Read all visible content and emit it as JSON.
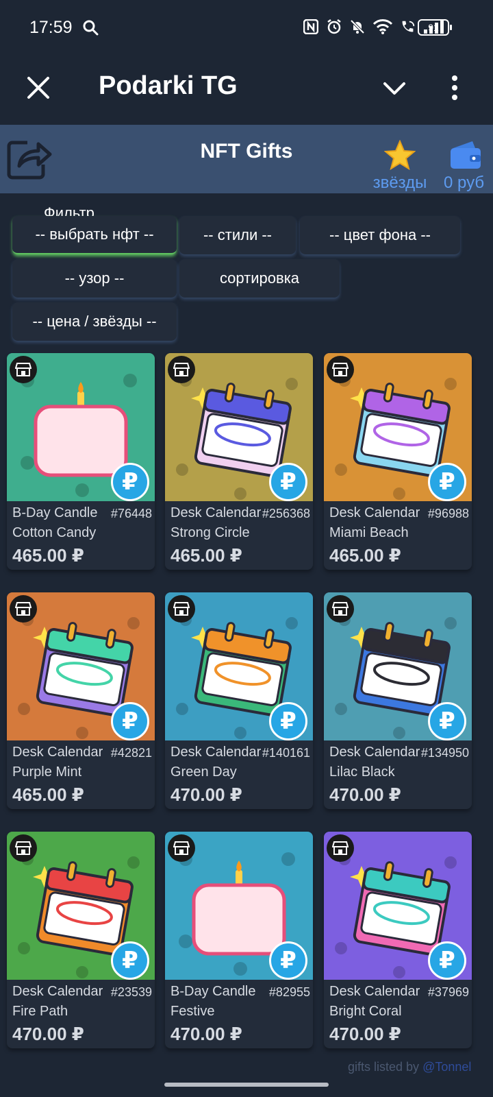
{
  "status_bar": {
    "time": "17:59",
    "battery": "91",
    "icons": [
      "search-icon",
      "nfc-icon",
      "alarm-icon",
      "mute-icon",
      "wifi-icon",
      "wifi-call-icon",
      "signal-icon"
    ]
  },
  "app_bar": {
    "title": "Podarki TG"
  },
  "banner": {
    "title": "NFT Gifts",
    "stars_label": "звёзды",
    "wallet_label": "0 руб"
  },
  "filters": {
    "caption": "Фильтр",
    "buttons": [
      {
        "label": "-- выбрать нфт --"
      },
      {
        "label": "-- стили --"
      },
      {
        "label": "-- цвет фона --"
      },
      {
        "label": "-- узор --"
      },
      {
        "label": "сортировка"
      },
      {
        "label": "-- цена / звёзды --"
      }
    ]
  },
  "gifts": [
    {
      "name": "B-Day Candle",
      "number": "#76448",
      "model": "Cotton Candy",
      "price": "465.00 ₽",
      "bg": "#3fae8e",
      "kind": "candle"
    },
    {
      "name": "Desk Calendar",
      "number": "#256368",
      "model": "Strong Circle",
      "price": "465.00 ₽",
      "bg": "#b4a04a",
      "kind": "calendar",
      "top": "#5a5ae0",
      "bottom": "#f0d0f0"
    },
    {
      "name": "Desk Calendar",
      "number": "#96988",
      "model": "Miami Beach",
      "price": "465.00 ₽",
      "bg": "#d99236",
      "kind": "calendar",
      "top": "#b064e6",
      "bottom": "#8ad6f0"
    },
    {
      "name": "Desk Calendar",
      "number": "#42821",
      "model": "Purple Mint",
      "price": "465.00 ₽",
      "bg": "#d57a3c",
      "kind": "calendar",
      "top": "#44d4a8",
      "bottom": "#9a7ae6"
    },
    {
      "name": "Desk Calendar",
      "number": "#140161",
      "model": "Green Day",
      "price": "470.00 ₽",
      "bg": "#3d9ec2",
      "kind": "calendar",
      "top": "#f0922a",
      "bottom": "#3ab87a"
    },
    {
      "name": "Desk Calendar",
      "number": "#134950",
      "model": "Lilac Black",
      "price": "470.00 ₽",
      "bg": "#4f9eb2",
      "kind": "calendar",
      "top": "#2c2c34",
      "bottom": "#3c78e0"
    },
    {
      "name": "Desk Calendar",
      "number": "#23539",
      "model": "Fire Path",
      "price": "470.00 ₽",
      "bg": "#4da84a",
      "kind": "calendar",
      "top": "#e84444",
      "bottom": "#f08a2a"
    },
    {
      "name": "B-Day Candle",
      "number": "#82955",
      "model": "Festive",
      "price": "470.00 ₽",
      "bg": "#3ba4c4",
      "kind": "candle"
    },
    {
      "name": "Desk Calendar",
      "number": "#37969",
      "model": "Bright Coral",
      "price": "470.00 ₽",
      "bg": "#7d5fe0",
      "kind": "calendar",
      "top": "#3ccac0",
      "bottom": "#f06ab4"
    }
  ],
  "footer": {
    "text": "gifts listed by",
    "link": "@Tonnel"
  }
}
